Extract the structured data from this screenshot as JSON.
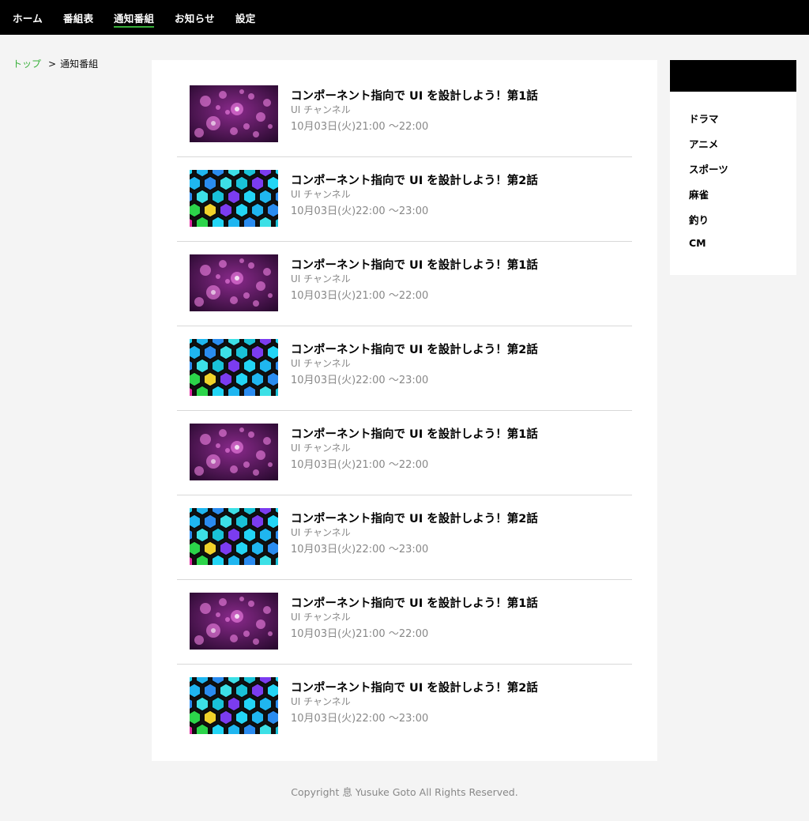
{
  "nav": {
    "items": [
      {
        "label": "ホーム",
        "active": false
      },
      {
        "label": "番組表",
        "active": false
      },
      {
        "label": "通知番組",
        "active": true
      },
      {
        "label": "お知らせ",
        "active": false
      },
      {
        "label": "設定",
        "active": false
      }
    ]
  },
  "breadcrumb": {
    "top_label": "トップ",
    "separator": ">",
    "current": "通知番組"
  },
  "programs": [
    {
      "title": "コンポーネント指向で UI を設計しよう！第1話",
      "channel": "UI チャンネル",
      "time": "10月03日(火)21:00 〜22:00",
      "thumbnail": "bokeh-purple"
    },
    {
      "title": "コンポーネント指向で UI を設計しよう！第2話",
      "channel": "UI チャンネル",
      "time": "10月03日(火)22:00 〜23:00",
      "thumbnail": "hexagon-neon"
    },
    {
      "title": "コンポーネント指向で UI を設計しよう！第1話",
      "channel": "UI チャンネル",
      "time": "10月03日(火)21:00 〜22:00",
      "thumbnail": "bokeh-purple"
    },
    {
      "title": "コンポーネント指向で UI を設計しよう！第2話",
      "channel": "UI チャンネル",
      "time": "10月03日(火)22:00 〜23:00",
      "thumbnail": "hexagon-neon"
    },
    {
      "title": "コンポーネント指向で UI を設計しよう！第1話",
      "channel": "UI チャンネル",
      "time": "10月03日(火)21:00 〜22:00",
      "thumbnail": "bokeh-purple"
    },
    {
      "title": "コンポーネント指向で UI を設計しよう！第2話",
      "channel": "UI チャンネル",
      "time": "10月03日(火)22:00 〜23:00",
      "thumbnail": "hexagon-neon"
    },
    {
      "title": "コンポーネント指向で UI を設計しよう！第1話",
      "channel": "UI チャンネル",
      "time": "10月03日(火)21:00 〜22:00",
      "thumbnail": "bokeh-purple"
    },
    {
      "title": "コンポーネント指向で UI を設計しよう！第2話",
      "channel": "UI チャンネル",
      "time": "10月03日(火)22:00 〜23:00",
      "thumbnail": "hexagon-neon"
    }
  ],
  "sidebar": {
    "header": "",
    "categories": [
      {
        "label": "ドラマ"
      },
      {
        "label": "アニメ"
      },
      {
        "label": "スポーツ"
      },
      {
        "label": "麻雀"
      },
      {
        "label": "釣り"
      },
      {
        "label": "CM"
      }
    ]
  },
  "footer": {
    "copyright": "Copyright 息 Yusuke Goto All Rights Reserved."
  },
  "colors": {
    "nav_bg": "#000000",
    "accent_green": "#38b03a",
    "page_bg": "#f4f4f4",
    "muted_text": "#888888"
  }
}
